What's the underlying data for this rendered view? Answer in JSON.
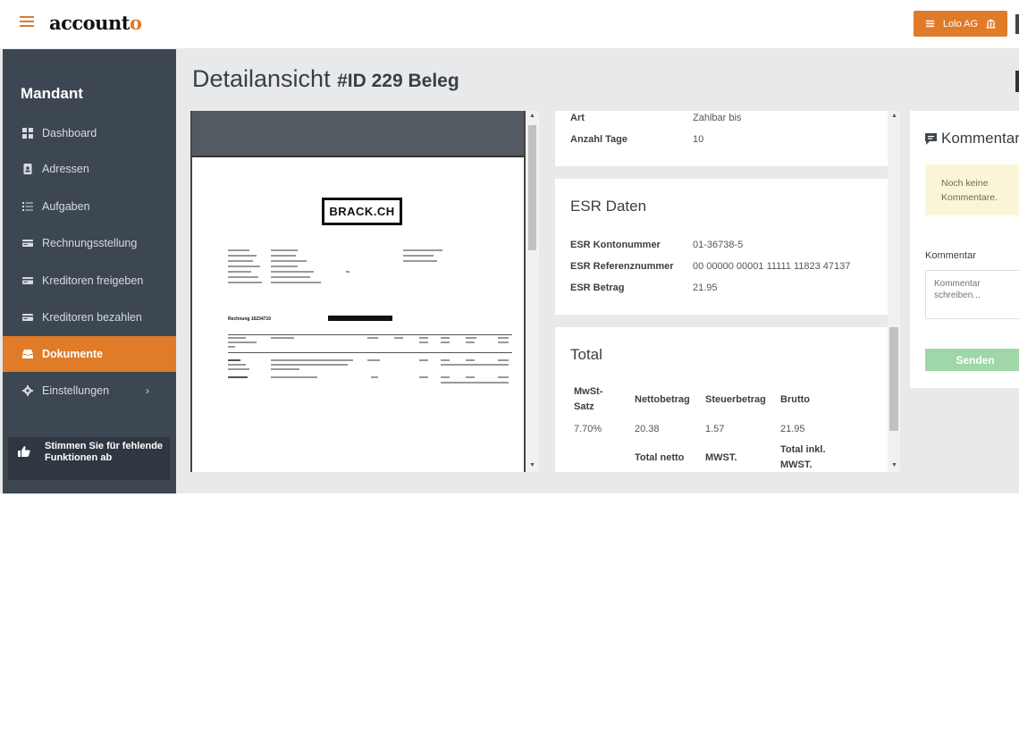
{
  "app": {
    "logo_main": "account",
    "logo_accent": "o",
    "company_label": "Lolo AG"
  },
  "sidebar": {
    "title": "Mandant",
    "items": [
      {
        "label": "Dashboard",
        "icon": "dashboard-icon"
      },
      {
        "label": "Adressen",
        "icon": "address-book-icon"
      },
      {
        "label": "Aufgaben",
        "icon": "list-icon"
      },
      {
        "label": "Rechnungsstellung",
        "icon": "card-icon"
      },
      {
        "label": "Kreditoren freigeben",
        "icon": "card-icon"
      },
      {
        "label": "Kreditoren bezahlen",
        "icon": "card-icon"
      },
      {
        "label": "Dokumente",
        "icon": "inbox-icon",
        "active": true
      },
      {
        "label": "Einstellungen",
        "icon": "gear-icon",
        "chevron": "›"
      }
    ],
    "vote": "Stimmen Sie für fehlende Funktionen ab"
  },
  "page": {
    "title": "Detailansicht",
    "subtitle": "#ID 229 Beleg"
  },
  "document": {
    "vendor_logo": "BRACK.CH",
    "heading": "Rechnung 16234710"
  },
  "payment": {
    "rows": [
      {
        "label": "Art",
        "value": "Zahlbar bis"
      },
      {
        "label": "Anzahl Tage",
        "value": "10"
      }
    ]
  },
  "esr": {
    "title": "ESR Daten",
    "rows": [
      {
        "label": "ESR Kontonummer",
        "value": "01-36738-5"
      },
      {
        "label": "ESR Referenznummer",
        "value": "00 00000 00001 11111 11823 47137"
      },
      {
        "label": "ESR Betrag",
        "value": "21.95"
      }
    ]
  },
  "total": {
    "title": "Total",
    "headers": [
      "MwSt-Satz",
      "Nettobetrag",
      "Steuerbetrag",
      "Brutto"
    ],
    "row": [
      "7.70%",
      "20.38",
      "1.57",
      "21.95"
    ],
    "footer": [
      "Total netto",
      "MWST.",
      "Total inkl. MWST."
    ]
  },
  "comments": {
    "title": "Kommentare",
    "empty": "Noch keine Kommentare.",
    "label": "Kommentar",
    "placeholder": "Kommentar schreiben...",
    "send": "Senden"
  },
  "colors": {
    "accent": "#e07b2a",
    "sidebar": "#3d4752",
    "send": "#9fd7a9",
    "notice": "#fbf5d8"
  }
}
